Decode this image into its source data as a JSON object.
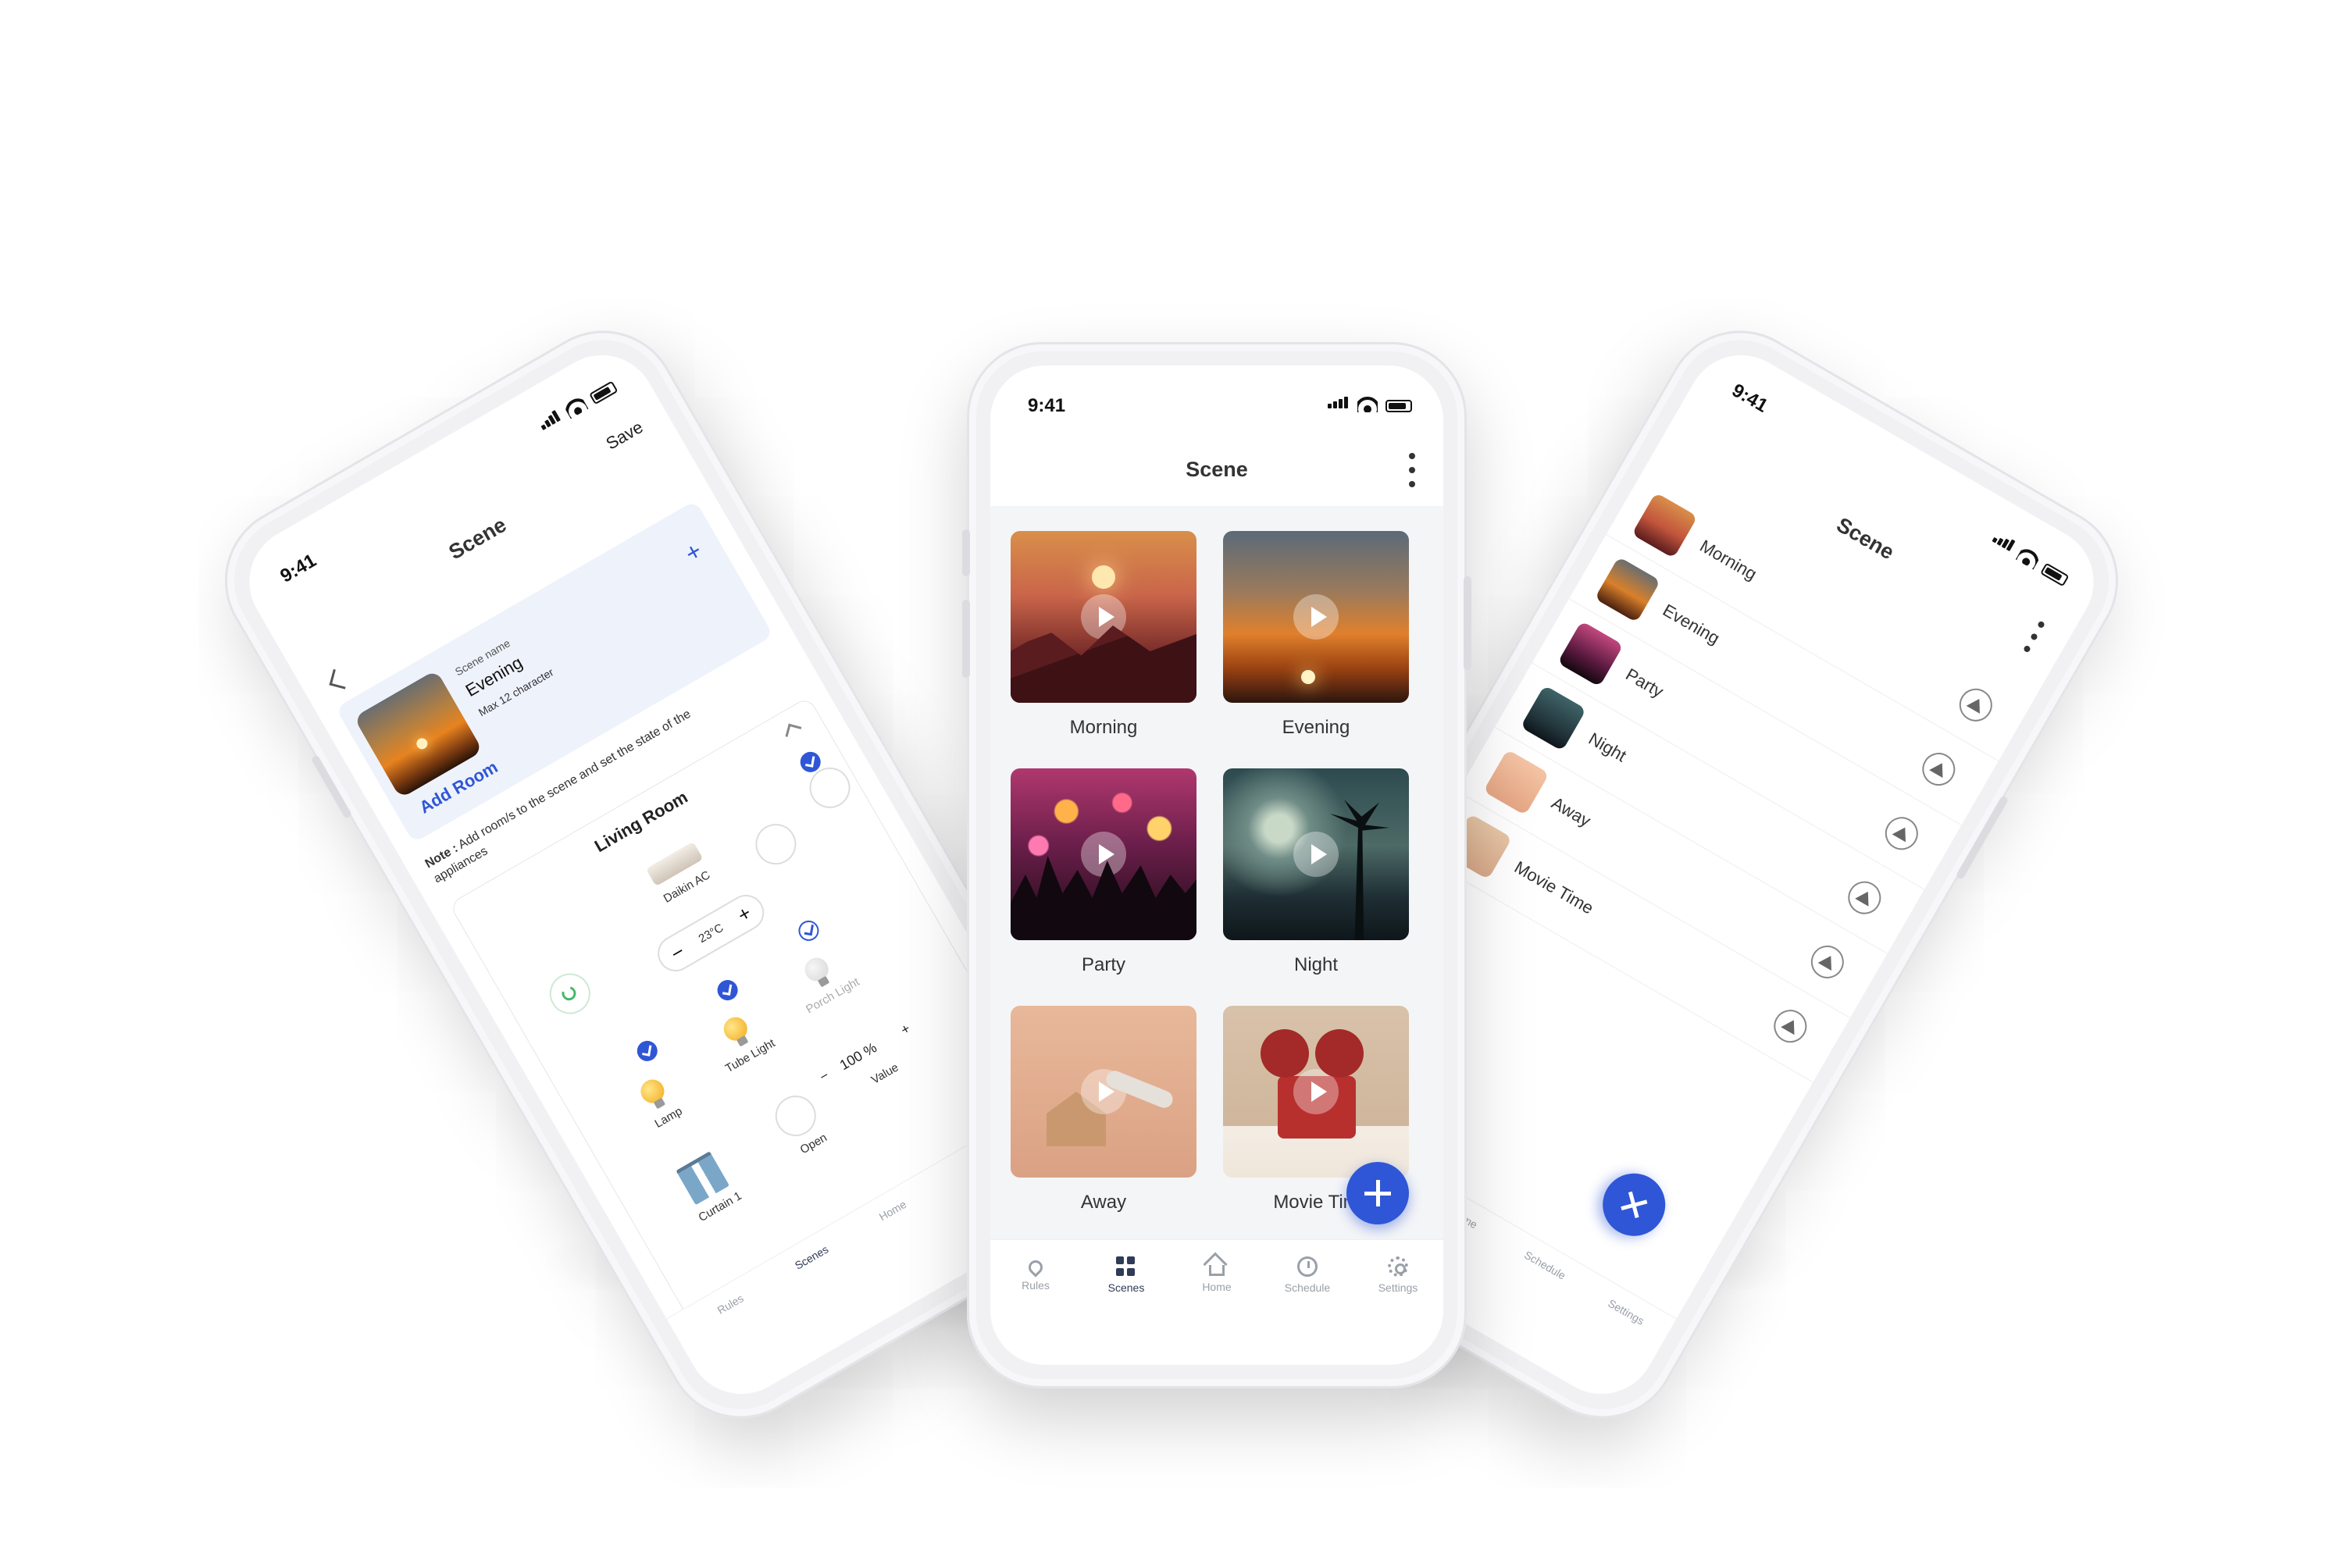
{
  "status": {
    "time": "9:41"
  },
  "center": {
    "title": "Scene",
    "scenes": [
      {
        "label": "Morning"
      },
      {
        "label": "Evening"
      },
      {
        "label": "Party"
      },
      {
        "label": "Night"
      },
      {
        "label": "Away"
      },
      {
        "label": "Movie Tim"
      }
    ],
    "nav": [
      {
        "label": "Rules",
        "icon": "location-pin-icon"
      },
      {
        "label": "Scenes",
        "icon": "grid-icon"
      },
      {
        "label": "Home",
        "icon": "home-icon"
      },
      {
        "label": "Schedule",
        "icon": "clock-icon"
      },
      {
        "label": "Settings",
        "icon": "gear-icon"
      }
    ],
    "active_nav": "Scenes"
  },
  "left": {
    "title": "Scene",
    "save_label": "Save",
    "scene_name_label": "Scene name",
    "scene_name_value": "Evening",
    "scene_name_hint": "Max 12 character",
    "add_room_label": "Add Room",
    "note_prefix": "Note :",
    "note_text": "Add room/s to the scene and set the state of the appliances",
    "room_title": "Living Room",
    "ac_label": "Daikin AC",
    "temperature": "23°C",
    "devices": [
      {
        "label": "Lamp",
        "checked": true
      },
      {
        "label": "Tube Light",
        "checked": true
      },
      {
        "label": "Porch Light",
        "checked": false
      }
    ],
    "curtain_label": "Curtain 1",
    "curtain_action": "Open",
    "curtain_value": "100 %",
    "value_label": "Value",
    "nav": [
      {
        "label": "Rules"
      },
      {
        "label": "Scenes"
      },
      {
        "label": "Home"
      }
    ]
  },
  "right": {
    "title": "Scene",
    "items": [
      {
        "label": "Morning"
      },
      {
        "label": "Evening"
      },
      {
        "label": "Party"
      },
      {
        "label": "Night"
      },
      {
        "label": "Away"
      },
      {
        "label": "Movie Time"
      }
    ],
    "nav": [
      {
        "label": "Home"
      },
      {
        "label": "Schedule"
      },
      {
        "label": "Settings"
      }
    ]
  },
  "colors": {
    "accent": "#2f56d6",
    "nav_active": "#2f3b57",
    "nav_inactive": "#9aa0a8",
    "background": "#ffffff"
  }
}
